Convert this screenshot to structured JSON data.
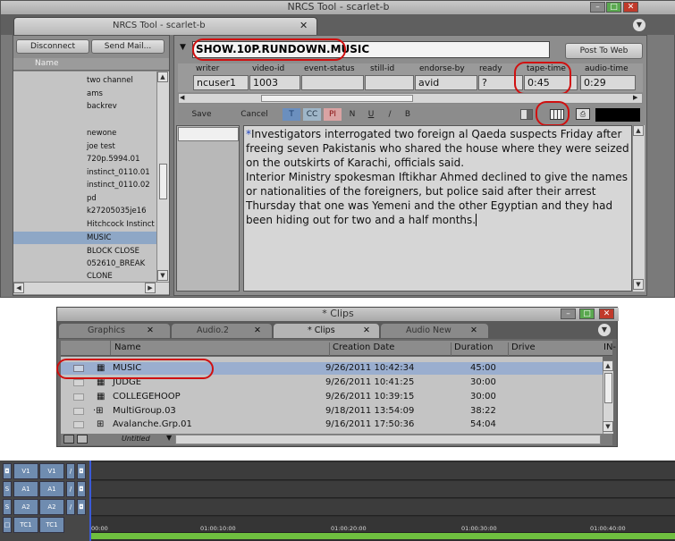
{
  "app": {
    "title": "NRCS Tool - scarlet-b",
    "tab_title": "NRCS Tool - scarlet-b"
  },
  "sidebar": {
    "disconnect_label": "Disconnect",
    "send_mail_label": "Send Mail...",
    "column_header": "Name",
    "items": [
      "two channel",
      "ams",
      "backrev",
      "",
      "newone",
      "joe test",
      "720p.5994.01",
      "instinct_0110.01",
      "instinct_0110.02",
      "pd",
      "k27205035je16",
      "Hitchcock Instinct",
      "MUSIC",
      "BLOCK CLOSE",
      "052610_BREAK",
      "CLONE"
    ],
    "selected_item": "MUSIC"
  },
  "story": {
    "path": "SHOW.10P.RUNDOWN.MUSIC",
    "post_button": "Post To Web",
    "fields": [
      {
        "header": "writer",
        "value": "ncuser1"
      },
      {
        "header": "video-id",
        "value": "1003"
      },
      {
        "header": "event-status",
        "value": ""
      },
      {
        "header": "still-id",
        "value": ""
      },
      {
        "header": "endorse-by",
        "value": "avid"
      },
      {
        "header": "ready",
        "value": "?"
      },
      {
        "header": "tape-time",
        "value": "0:45"
      },
      {
        "header": "audio-time",
        "value": "0:29"
      }
    ],
    "toolbar": {
      "save_label": "Save",
      "cancel_label": "Cancel",
      "format_buttons": [
        "T",
        "CC",
        "PI",
        "N",
        "U",
        "/",
        "B"
      ]
    },
    "text_p1": "Investigators interrogated two foreign al Qaeda suspects Friday after freeing seven Pakistanis who shared the house where they were seized on the outskirts of Karachi, officials said.",
    "text_p2": "Interior Ministry spokesman Iftikhar Ahmed declined to give the names or nationalities of the foreigners, but police said after their arrest Thursday that one was Yemeni and the other Egyptian and they had been hiding out for two and a half months."
  },
  "clips": {
    "title": "* Clips",
    "tabs": [
      {
        "label": "Graphics"
      },
      {
        "label": "Audio.2"
      },
      {
        "label": "* Clips"
      },
      {
        "label": "Audio New"
      }
    ],
    "columns": [
      "Name",
      "Creation Date",
      "Duration",
      "Drive",
      "IN-"
    ],
    "rows": [
      {
        "name": "MUSIC",
        "date": "9/26/2011 10:42:34",
        "duration": "45:00"
      },
      {
        "name": "JUDGE",
        "date": "9/26/2011 10:41:25",
        "duration": "30:00"
      },
      {
        "name": "COLLEGEHOOP",
        "date": "9/26/2011 10:39:15",
        "duration": "30:00"
      },
      {
        "name": "MultiGroup.03",
        "date": "9/18/2011 13:54:09",
        "duration": "38:22"
      },
      {
        "name": "Avalanche.Grp.01",
        "date": "9/16/2011 17:50:36",
        "duration": "54:04"
      }
    ],
    "bin_view": "Untitled"
  },
  "timeline": {
    "tracks": [
      {
        "src": "V1",
        "rec": "V1"
      },
      {
        "src": "A1",
        "rec": "A1"
      },
      {
        "src": "A2",
        "rec": "A2"
      },
      {
        "src": "TC1",
        "rec": "TC1"
      }
    ],
    "ticks": [
      "00:00",
      "01:00:10:00",
      "01:00:20:00",
      "01:00:30:00",
      "01:00:40:00"
    ]
  }
}
